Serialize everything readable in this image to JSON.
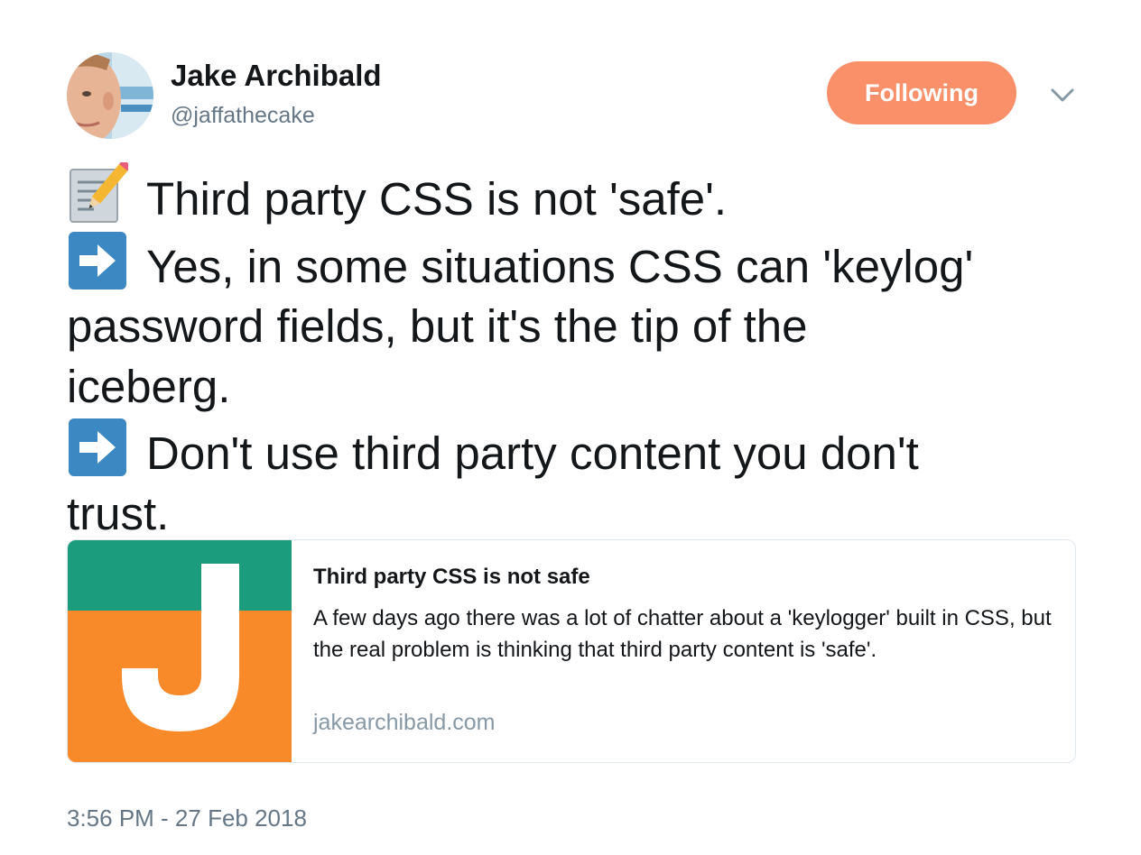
{
  "author": {
    "display_name": "Jake Archibald",
    "handle": "@jaffathecake",
    "avatar_icon": "avatar-photo"
  },
  "header": {
    "follow_label": "Following",
    "follow_color": "#f9906a",
    "caret_icon": "chevron-down-icon"
  },
  "tweet": {
    "lines": [
      {
        "emoji": "memo-icon",
        "text": "Third party CSS is not 'safe'."
      },
      {
        "emoji": "right-arrow-icon",
        "text": "Yes, in some situations CSS can 'keylog'"
      },
      {
        "emoji": "",
        "text": "password fields, but it's the tip of the"
      },
      {
        "emoji": "",
        "text": "iceberg."
      },
      {
        "emoji": "right-arrow-icon",
        "text": "Don't use third party content you don't"
      },
      {
        "emoji": "",
        "text": "trust."
      }
    ]
  },
  "card": {
    "title": "Third party CSS is not safe",
    "description": "A few days ago there was a lot of chatter about a 'keylogger' built in CSS, but the real problem is thinking that third party content is 'safe'.",
    "domain": "jakearchibald.com",
    "image_icon": "j-logo",
    "logo_colors": {
      "top": "#1b9c7d",
      "bottom": "#f98a2a",
      "letter": "#ffffff"
    }
  },
  "timestamp": "3:56 PM - 27 Feb 2018",
  "colors": {
    "text": "#14171a",
    "secondary": "#657786",
    "domain": "#8899a6",
    "border": "#e1e8ed"
  }
}
